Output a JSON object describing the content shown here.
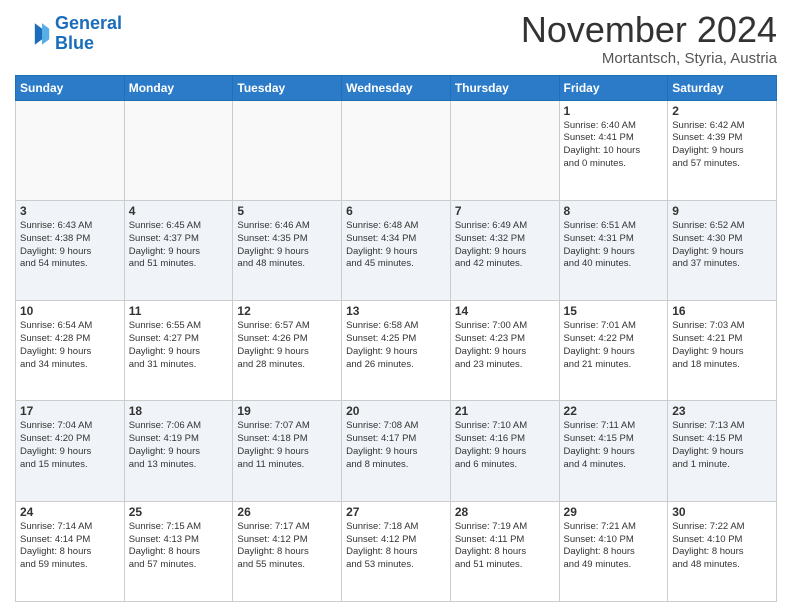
{
  "header": {
    "logo_line1": "General",
    "logo_line2": "Blue",
    "month": "November 2024",
    "location": "Mortantsch, Styria, Austria"
  },
  "weekdays": [
    "Sunday",
    "Monday",
    "Tuesday",
    "Wednesday",
    "Thursday",
    "Friday",
    "Saturday"
  ],
  "weeks": [
    [
      {
        "day": "",
        "info": ""
      },
      {
        "day": "",
        "info": ""
      },
      {
        "day": "",
        "info": ""
      },
      {
        "day": "",
        "info": ""
      },
      {
        "day": "",
        "info": ""
      },
      {
        "day": "1",
        "info": "Sunrise: 6:40 AM\nSunset: 4:41 PM\nDaylight: 10 hours\nand 0 minutes."
      },
      {
        "day": "2",
        "info": "Sunrise: 6:42 AM\nSunset: 4:39 PM\nDaylight: 9 hours\nand 57 minutes."
      }
    ],
    [
      {
        "day": "3",
        "info": "Sunrise: 6:43 AM\nSunset: 4:38 PM\nDaylight: 9 hours\nand 54 minutes."
      },
      {
        "day": "4",
        "info": "Sunrise: 6:45 AM\nSunset: 4:37 PM\nDaylight: 9 hours\nand 51 minutes."
      },
      {
        "day": "5",
        "info": "Sunrise: 6:46 AM\nSunset: 4:35 PM\nDaylight: 9 hours\nand 48 minutes."
      },
      {
        "day": "6",
        "info": "Sunrise: 6:48 AM\nSunset: 4:34 PM\nDaylight: 9 hours\nand 45 minutes."
      },
      {
        "day": "7",
        "info": "Sunrise: 6:49 AM\nSunset: 4:32 PM\nDaylight: 9 hours\nand 42 minutes."
      },
      {
        "day": "8",
        "info": "Sunrise: 6:51 AM\nSunset: 4:31 PM\nDaylight: 9 hours\nand 40 minutes."
      },
      {
        "day": "9",
        "info": "Sunrise: 6:52 AM\nSunset: 4:30 PM\nDaylight: 9 hours\nand 37 minutes."
      }
    ],
    [
      {
        "day": "10",
        "info": "Sunrise: 6:54 AM\nSunset: 4:28 PM\nDaylight: 9 hours\nand 34 minutes."
      },
      {
        "day": "11",
        "info": "Sunrise: 6:55 AM\nSunset: 4:27 PM\nDaylight: 9 hours\nand 31 minutes."
      },
      {
        "day": "12",
        "info": "Sunrise: 6:57 AM\nSunset: 4:26 PM\nDaylight: 9 hours\nand 28 minutes."
      },
      {
        "day": "13",
        "info": "Sunrise: 6:58 AM\nSunset: 4:25 PM\nDaylight: 9 hours\nand 26 minutes."
      },
      {
        "day": "14",
        "info": "Sunrise: 7:00 AM\nSunset: 4:23 PM\nDaylight: 9 hours\nand 23 minutes."
      },
      {
        "day": "15",
        "info": "Sunrise: 7:01 AM\nSunset: 4:22 PM\nDaylight: 9 hours\nand 21 minutes."
      },
      {
        "day": "16",
        "info": "Sunrise: 7:03 AM\nSunset: 4:21 PM\nDaylight: 9 hours\nand 18 minutes."
      }
    ],
    [
      {
        "day": "17",
        "info": "Sunrise: 7:04 AM\nSunset: 4:20 PM\nDaylight: 9 hours\nand 15 minutes."
      },
      {
        "day": "18",
        "info": "Sunrise: 7:06 AM\nSunset: 4:19 PM\nDaylight: 9 hours\nand 13 minutes."
      },
      {
        "day": "19",
        "info": "Sunrise: 7:07 AM\nSunset: 4:18 PM\nDaylight: 9 hours\nand 11 minutes."
      },
      {
        "day": "20",
        "info": "Sunrise: 7:08 AM\nSunset: 4:17 PM\nDaylight: 9 hours\nand 8 minutes."
      },
      {
        "day": "21",
        "info": "Sunrise: 7:10 AM\nSunset: 4:16 PM\nDaylight: 9 hours\nand 6 minutes."
      },
      {
        "day": "22",
        "info": "Sunrise: 7:11 AM\nSunset: 4:15 PM\nDaylight: 9 hours\nand 4 minutes."
      },
      {
        "day": "23",
        "info": "Sunrise: 7:13 AM\nSunset: 4:15 PM\nDaylight: 9 hours\nand 1 minute."
      }
    ],
    [
      {
        "day": "24",
        "info": "Sunrise: 7:14 AM\nSunset: 4:14 PM\nDaylight: 8 hours\nand 59 minutes."
      },
      {
        "day": "25",
        "info": "Sunrise: 7:15 AM\nSunset: 4:13 PM\nDaylight: 8 hours\nand 57 minutes."
      },
      {
        "day": "26",
        "info": "Sunrise: 7:17 AM\nSunset: 4:12 PM\nDaylight: 8 hours\nand 55 minutes."
      },
      {
        "day": "27",
        "info": "Sunrise: 7:18 AM\nSunset: 4:12 PM\nDaylight: 8 hours\nand 53 minutes."
      },
      {
        "day": "28",
        "info": "Sunrise: 7:19 AM\nSunset: 4:11 PM\nDaylight: 8 hours\nand 51 minutes."
      },
      {
        "day": "29",
        "info": "Sunrise: 7:21 AM\nSunset: 4:10 PM\nDaylight: 8 hours\nand 49 minutes."
      },
      {
        "day": "30",
        "info": "Sunrise: 7:22 AM\nSunset: 4:10 PM\nDaylight: 8 hours\nand 48 minutes."
      }
    ]
  ]
}
